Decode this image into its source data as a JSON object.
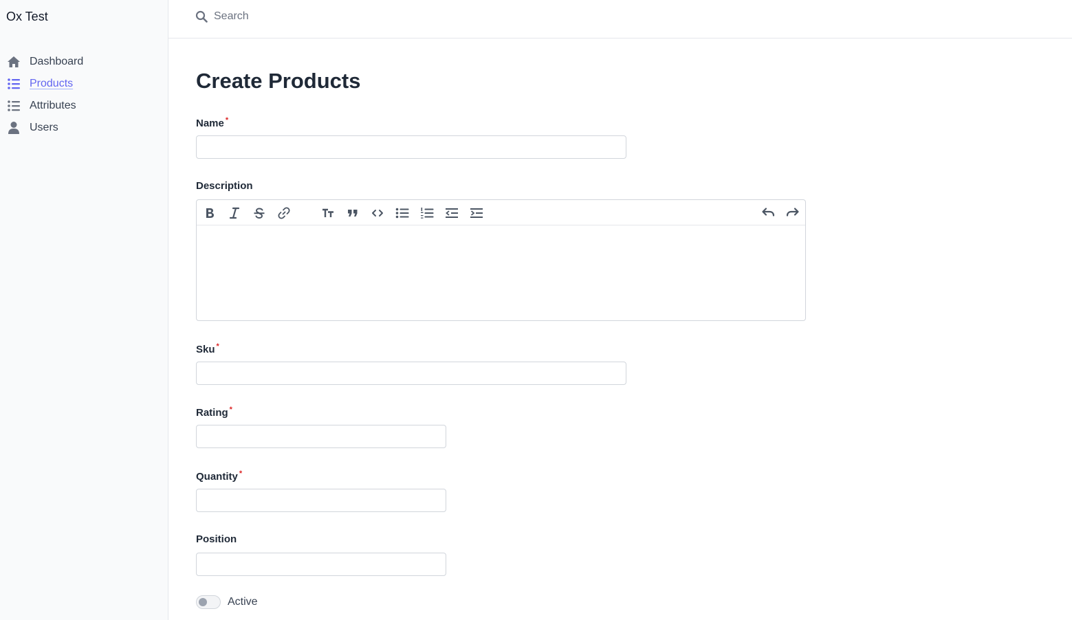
{
  "app": {
    "title": "Ox Test"
  },
  "sidebar": {
    "items": [
      {
        "label": "Dashboard",
        "icon": "home-icon",
        "active": false
      },
      {
        "label": "Products",
        "icon": "list-icon",
        "active": true
      },
      {
        "label": "Attributes",
        "icon": "list-icon",
        "active": false
      },
      {
        "label": "Users",
        "icon": "user-icon",
        "active": false
      }
    ]
  },
  "search": {
    "placeholder": "Search",
    "value": ""
  },
  "page": {
    "title": "Create Products"
  },
  "form": {
    "name": {
      "label": "Name",
      "required_mark": "*",
      "value": ""
    },
    "description": {
      "label": "Description",
      "toolbar": [
        "bold-icon",
        "italic-icon",
        "strikethrough-icon",
        "link-icon",
        "heading-icon",
        "quote-icon",
        "code-icon",
        "bullet-list-icon",
        "numbered-list-icon",
        "outdent-icon",
        "indent-icon",
        "undo-icon",
        "redo-icon"
      ],
      "value": ""
    },
    "sku": {
      "label": "Sku",
      "required_mark": "*",
      "value": ""
    },
    "rating": {
      "label": "Rating",
      "required_mark": "*",
      "value": ""
    },
    "quantity": {
      "label": "Quantity",
      "required_mark": "*",
      "value": ""
    },
    "position": {
      "label": "Position",
      "value": ""
    },
    "active": {
      "label": "Active",
      "checked": false
    }
  },
  "colors": {
    "accent": "#6366f1",
    "required": "#dc2626",
    "sidebar_bg": "#f9fafb"
  }
}
